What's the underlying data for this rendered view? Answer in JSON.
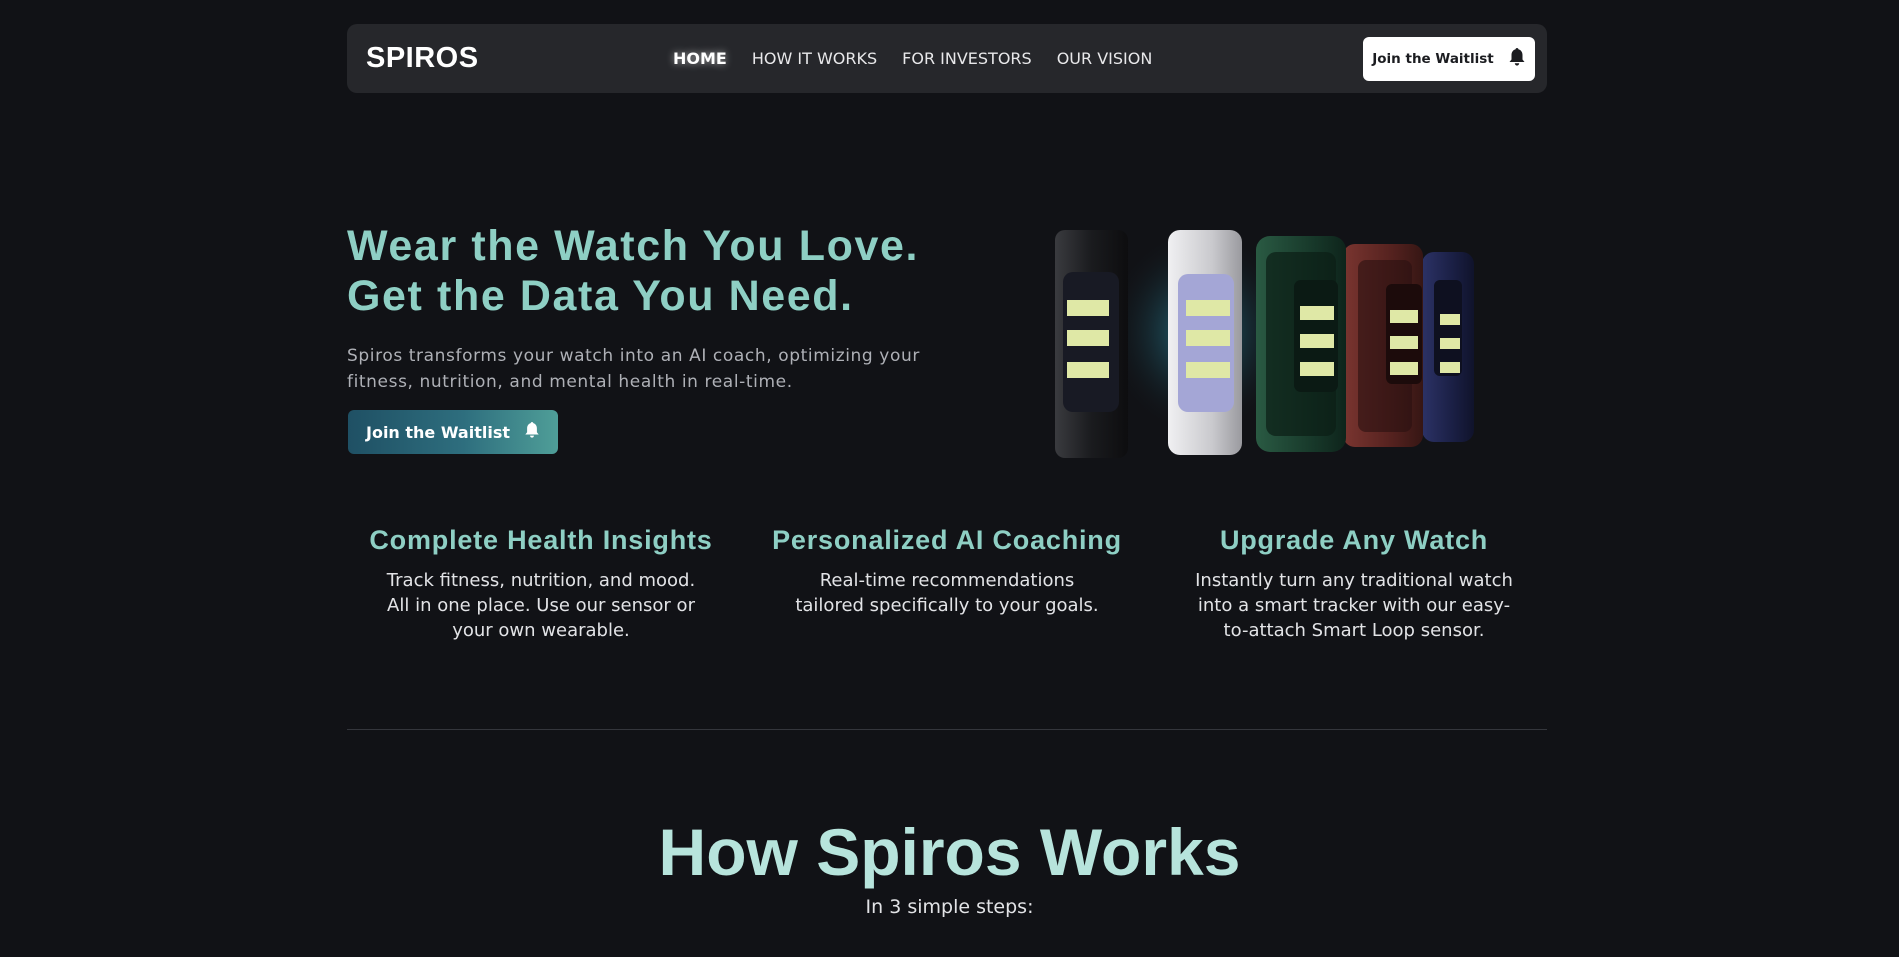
{
  "brand": {
    "logo": "SPIROS"
  },
  "nav": {
    "links": [
      "HOME",
      "HOW IT WORKS",
      "FOR INVESTORS",
      "OUR VISION"
    ],
    "active": "HOME",
    "cta_label": "Join the Waitlist",
    "cta_icon": "bell-icon"
  },
  "hero": {
    "title_line1": "Wear the Watch You Love.",
    "title_line2": "Get the Data You Need.",
    "subtitle": "Spiros transforms your watch into an AI coach, optimizing your fitness, nutrition, and mental health in real-time.",
    "cta_label": "Join the Waitlist",
    "cta_icon": "bell-icon"
  },
  "features": [
    {
      "title": "Complete Health Insights",
      "text": "Track fitness, nutrition, and mood. All in one place. Use our sensor or your own wearable."
    },
    {
      "title": "Personalized AI Coaching",
      "text": "Real-time recommendations tailored specifically to your goals."
    },
    {
      "title": "Upgrade Any Watch",
      "text": "Instantly turn any traditional watch into a smart tracker with our easy-to-attach Smart Loop sensor."
    }
  ],
  "how": {
    "title": "How Spiros Works",
    "subtitle": "In 3 simple steps:"
  },
  "colors": {
    "background": "#111216",
    "accent": "#8ecfc4",
    "nav_bg": "#26272b"
  }
}
